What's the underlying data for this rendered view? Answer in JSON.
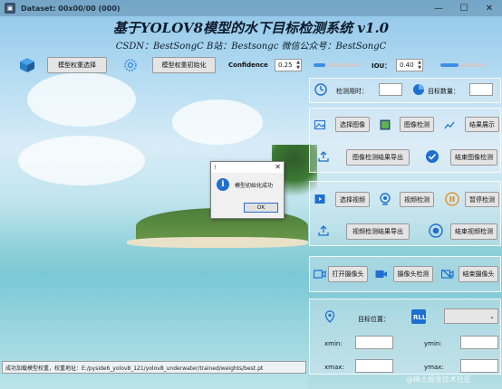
{
  "window": {
    "title": "Dataset: 00x00/00 (000)",
    "controls": [
      "—",
      "☐",
      "✕"
    ]
  },
  "header": {
    "title": "基于YOLOV8模型的水下目标检测系统 v1.0",
    "subtitle": "CSDN：BestSongC   B站：Bestsongc   微信公众号：BestSongC"
  },
  "toolbar": {
    "model_select_label": "模型权重选择",
    "model_init_label": "模型权重初始化",
    "confidence_label": "Confidence",
    "confidence_value": "0.25",
    "confidence_level": 0.25,
    "iou_label": "IOU：",
    "iou_value": "0.40",
    "iou_level": 0.4
  },
  "panel": {
    "time_label": "检测用时：",
    "count_label": "目标数量：",
    "select_image": "选择图像",
    "image_detect": "图像检测",
    "show_result": "结果展示",
    "export_image_result": "图像检测结果导出",
    "end_image_detect": "结束图像检测",
    "select_video": "选择视频",
    "video_detect": "视频检测",
    "pause_detect": "暂停检测",
    "export_video_result": "视频检测结果导出",
    "end_video_detect": "结束视频检测",
    "open_camera": "打开摄像头",
    "camera_detect": "摄像头检测",
    "close_camera": "结束摄像头",
    "target_position_label": "目标位置：",
    "xmin_label": "xmin:",
    "ymin_label": "ymin:",
    "xmax_label": "xmax:",
    "ymax_label": "ymax:"
  },
  "status": {
    "message": "成功加载模型权重，权重地址：E:/pyside6_yolov8_121/yolov8_underwater/trained/weights/best.pt"
  },
  "watermark": "@稀土掘金技术社区",
  "dialog": {
    "title": "!",
    "close": "✕",
    "message": "模型初始化成功",
    "ok_label": "OK"
  },
  "colors": {
    "accent": "#1f6fd1",
    "slider_fill": "#3d8ee6"
  }
}
